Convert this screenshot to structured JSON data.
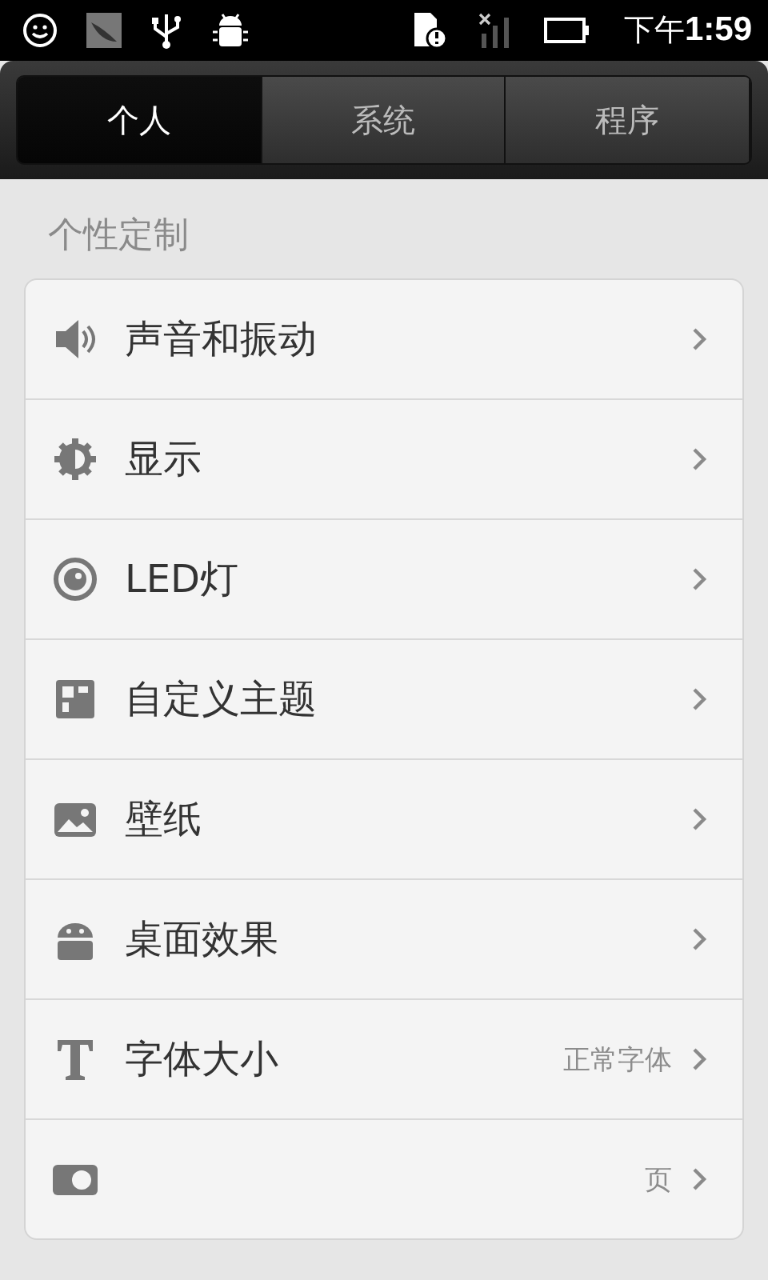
{
  "status_bar": {
    "time_prefix": "下午",
    "time": "1:59"
  },
  "tabs": [
    {
      "label": "个人",
      "selected": true
    },
    {
      "label": "系统",
      "selected": false
    },
    {
      "label": "程序",
      "selected": false
    }
  ],
  "section": {
    "title": "个性定制"
  },
  "items": [
    {
      "kind": "sound",
      "label": "声音和振动"
    },
    {
      "kind": "display",
      "label": "显示"
    },
    {
      "kind": "led",
      "label": "LED灯"
    },
    {
      "kind": "theme",
      "label": "自定义主题"
    },
    {
      "kind": "wallpaper",
      "label": "壁纸"
    },
    {
      "kind": "desktop",
      "label": "桌面效果"
    },
    {
      "kind": "font",
      "label": "字体大小",
      "value": "正常字体"
    },
    {
      "kind": "toggle",
      "value": "页"
    }
  ]
}
